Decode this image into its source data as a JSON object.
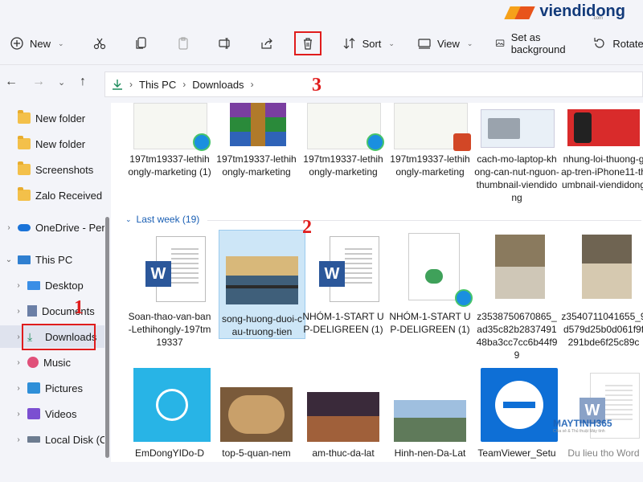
{
  "brand": {
    "name": "viendidong",
    "sub": ".com"
  },
  "toolbar": {
    "new_label": "New",
    "sort_label": "Sort",
    "view_label": "View",
    "background_label": "Set as background",
    "rotate_label": "Rotate"
  },
  "address": {
    "crumbs": [
      "This PC",
      "Downloads"
    ]
  },
  "sidebar": {
    "items": [
      {
        "label": "New folder"
      },
      {
        "label": "New folder"
      },
      {
        "label": "Screenshots"
      },
      {
        "label": "Zalo Received F"
      },
      {
        "label": "OneDrive - Perso"
      },
      {
        "label": "This PC"
      },
      {
        "label": "Desktop"
      },
      {
        "label": "Documents"
      },
      {
        "label": "Downloads"
      },
      {
        "label": "Music"
      },
      {
        "label": "Pictures"
      },
      {
        "label": "Videos"
      },
      {
        "label": "Local Disk (C:)"
      }
    ]
  },
  "group": {
    "label": "Last week (19)"
  },
  "row1": [
    {
      "name": "197tm19337-lethihongly-marketing (1)"
    },
    {
      "name": "197tm19337-lethihongly-marketing"
    },
    {
      "name": "197tm19337-lethihongly-marketing"
    },
    {
      "name": "197tm19337-lethihongly-marketing"
    },
    {
      "name": "cach-mo-laptop-khong-can-nut-nguon-thumbnail-viendidong"
    },
    {
      "name": "nhung-loi-thuong-gap-tren-iPhone11-thumbnail-viendidong"
    }
  ],
  "row2": [
    {
      "name": "Soan-thao-van-ban-Lethihongly-197tm19337"
    },
    {
      "name": "song-huong-duoi-cau-truong-tien"
    },
    {
      "name": "NHÓM-1-START UP-DELIGREEN (1)"
    },
    {
      "name": "NHÓM-1-START UP-DELIGREEN (1)"
    },
    {
      "name": "z3538750670865_ad35c82b283749148ba3cc7cc6b44f99"
    },
    {
      "name": "z3540711041655_9d579d25b0d061f9f291bde6f25c89c"
    }
  ],
  "row3": [
    {
      "name": "EmDongYIDo-D"
    },
    {
      "name": "top-5-quan-nem"
    },
    {
      "name": "am-thuc-da-lat"
    },
    {
      "name": "Hinh-nen-Da-Lat"
    },
    {
      "name": "TeamViewer_Setu"
    },
    {
      "name": "Du lieu tho Word"
    }
  ],
  "annotations": [
    "1",
    "2",
    "3"
  ],
  "watermark": {
    "logo": "MAYTINH365",
    "sub": "Chia sẻ & Thủ thuật Máy tính"
  }
}
